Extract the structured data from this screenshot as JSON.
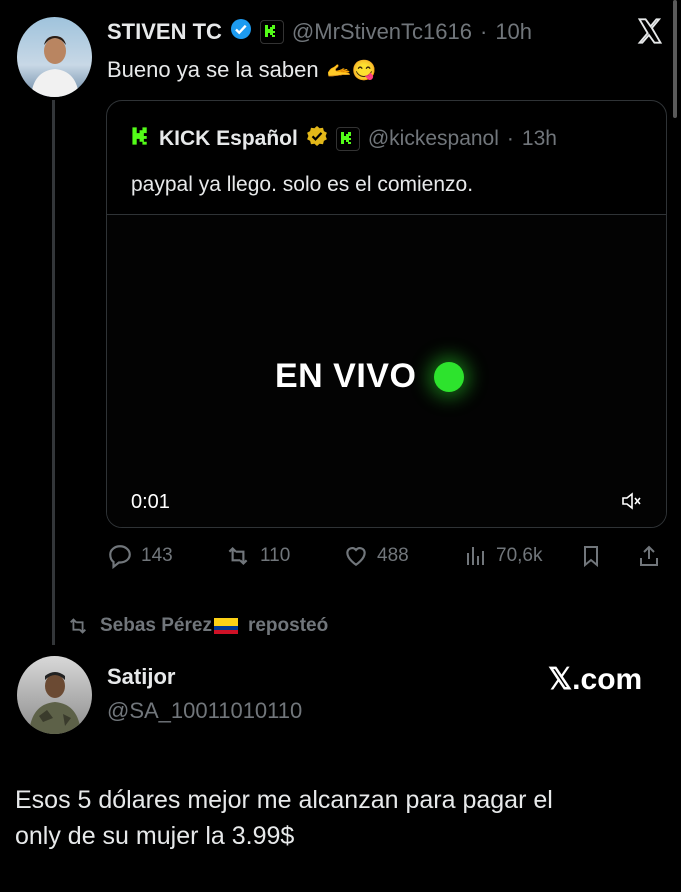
{
  "tweet": {
    "author_name": "STIVEN TC",
    "handle": "@MrStivenTc1616",
    "separator": "·",
    "time": "10h",
    "text": "Bueno ya se la saben",
    "emoji_text": "🫴😋"
  },
  "quote": {
    "author_name": "KICK Español",
    "handle": "@kickespanol",
    "separator": "·",
    "time": "13h",
    "text": "paypal ya llego. solo es el comienzo.",
    "video_text": "EN VIVO",
    "video_time": "0:01",
    "live_color": "#2de32d"
  },
  "actions": {
    "replies": "143",
    "reposts": "110",
    "likes": "488",
    "views": "70,6k"
  },
  "repost_bar": {
    "text": "Sebas Pérez",
    "suffix": "reposteó"
  },
  "reply": {
    "author_name": "Satijor",
    "handle": "@SA_10011010110",
    "brand": "𝕏.com",
    "text_line1": "Esos 5 dólares mejor me alcanzan para pagar el",
    "text_line2": "only de su mujer la 3.99$"
  },
  "colors": {
    "verified_blue": "#1d9bf0",
    "verified_gold": "#e2b719",
    "kick_green": "#53fc18"
  }
}
